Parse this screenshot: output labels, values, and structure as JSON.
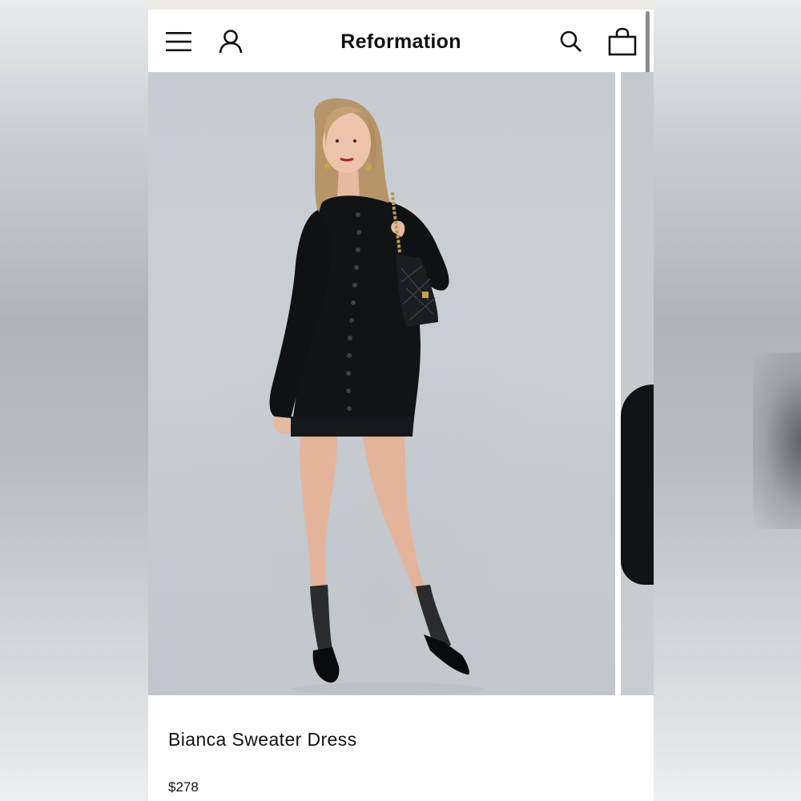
{
  "header": {
    "brand": "Reformation",
    "icons": [
      "menu-icon",
      "account-icon",
      "search-icon",
      "bag-icon"
    ]
  },
  "product": {
    "title": "Bianca Sweater Dress",
    "price": "$278"
  },
  "gallery": {
    "current_image": 1
  },
  "colors": {
    "background": "#ffffff",
    "text": "#111111",
    "photo_backdrop": "#c6ccd1",
    "dress": "#111315"
  }
}
